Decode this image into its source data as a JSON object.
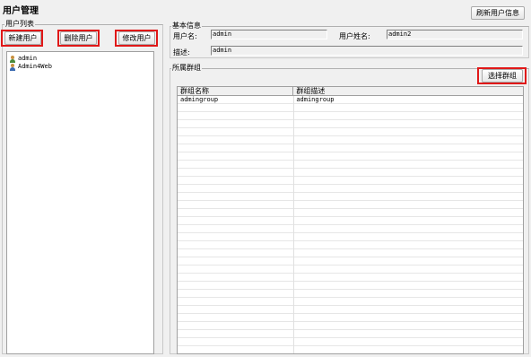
{
  "page": {
    "title": "用户管理"
  },
  "toolbar": {
    "refresh_label": "刷新用户信息"
  },
  "user_list": {
    "legend": "用户列表",
    "new_label": "新建用户",
    "delete_label": "删除用户",
    "edit_label": "修改用户",
    "users": [
      {
        "name": "admin",
        "icon": "user-icon"
      },
      {
        "name": "Admin4Web",
        "icon": "user-icon"
      }
    ]
  },
  "basic_info": {
    "legend": "基本信息",
    "username_label": "用户名:",
    "username_value": "admin",
    "fullname_label": "用户姓名:",
    "fullname_value": "admin2",
    "desc_label": "描述:",
    "desc_value": "admin"
  },
  "groups": {
    "legend": "所属群组",
    "select_label": "选择群组",
    "columns": [
      "群组名称",
      "群组描述"
    ],
    "rows": [
      [
        "admingroup",
        "admingroup"
      ]
    ]
  },
  "colors": {
    "highlight": "#e01818",
    "background": "#f0f0f0"
  }
}
